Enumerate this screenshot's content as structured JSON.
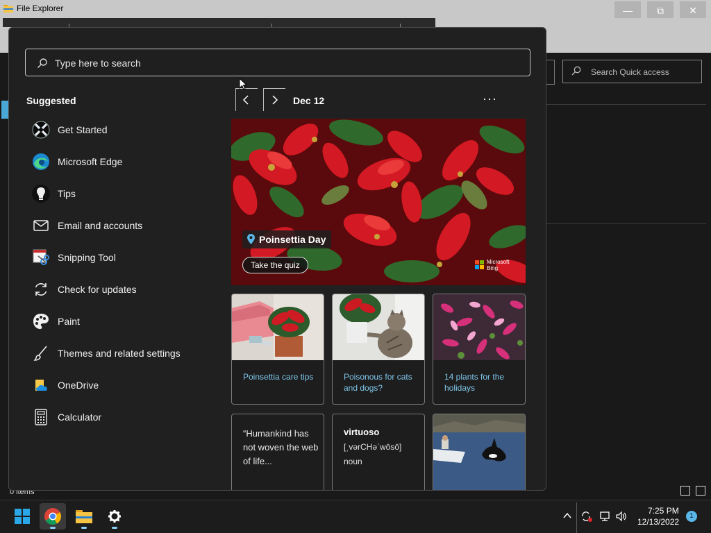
{
  "window": {
    "title": "File Explorer",
    "status": "0 items",
    "search_placeholder": "Search Quick access"
  },
  "start": {
    "search_placeholder": "Type here to search",
    "suggested_title": "Suggested",
    "apps": [
      {
        "label": "Get Started",
        "icon": "get-started-icon"
      },
      {
        "label": "Microsoft Edge",
        "icon": "edge-icon"
      },
      {
        "label": "Tips",
        "icon": "tips-icon"
      },
      {
        "label": "Email and accounts",
        "icon": "mail-icon"
      },
      {
        "label": "Snipping Tool",
        "icon": "snipping-tool-icon"
      },
      {
        "label": "Check for updates",
        "icon": "refresh-icon"
      },
      {
        "label": "Paint",
        "icon": "paint-palette-icon"
      },
      {
        "label": "Themes and related settings",
        "icon": "brush-icon"
      },
      {
        "label": "OneDrive",
        "icon": "onedrive-icon"
      },
      {
        "label": "Calculator",
        "icon": "calculator-icon"
      }
    ],
    "spotlight": {
      "date": "Dec 12",
      "more": "···",
      "hero_title": "Poinsettia Day",
      "hero_button": "Take the quiz",
      "brand_line1": "Microsoft",
      "brand_line2": "Bing",
      "cards": [
        {
          "caption": "Poinsettia care tips"
        },
        {
          "caption": "Poisonous for cats and dogs?"
        },
        {
          "caption": "14 plants for the holidays"
        }
      ],
      "quote_card": "“Humankind has not woven the web of life...",
      "word_card": {
        "word": "virtuoso",
        "pronunciation": "[ˌvərCHəˈwōsō]",
        "part_of_speech": "noun"
      }
    }
  },
  "taskbar": {
    "items": [
      "start-button",
      "chrome",
      "file-explorer",
      "settings"
    ],
    "time": "7:25 PM",
    "date": "12/13/2022",
    "notifications": "1"
  },
  "colors": {
    "accent": "#5ab7e8",
    "caption": "#7ec5ea",
    "menu_bg": "#202020"
  }
}
